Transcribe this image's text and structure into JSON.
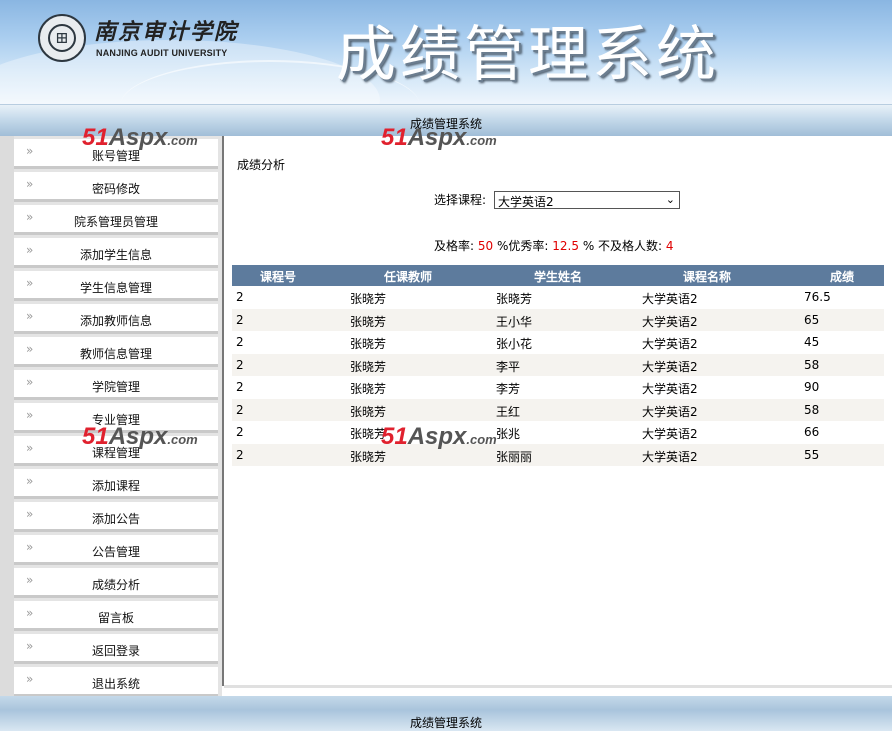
{
  "header": {
    "university_cn": "南京审计学院",
    "university_en": "NANJING AUDIT UNIVERSITY",
    "system_title": "成绩管理系统",
    "logo_icon": "university-seal-icon"
  },
  "topbar": {
    "label": "成绩管理系统"
  },
  "footer": {
    "label": "成绩管理系统"
  },
  "sidebar": {
    "items": [
      {
        "label": "账号管理"
      },
      {
        "label": "密码修改"
      },
      {
        "label": "院系管理员管理"
      },
      {
        "label": "添加学生信息"
      },
      {
        "label": "学生信息管理"
      },
      {
        "label": "添加教师信息"
      },
      {
        "label": "教师信息管理"
      },
      {
        "label": "学院管理"
      },
      {
        "label": "专业管理"
      },
      {
        "label": "课程管理"
      },
      {
        "label": "添加课程"
      },
      {
        "label": "添加公告"
      },
      {
        "label": "公告管理"
      },
      {
        "label": "成绩分析"
      },
      {
        "label": "留言板"
      },
      {
        "label": "返回登录"
      },
      {
        "label": "退出系统"
      }
    ],
    "chevron": "»"
  },
  "main": {
    "title": "成绩分析",
    "course_label": "选择课程:",
    "course_selected": "大学英语2",
    "stats": {
      "pass_label": "及格率:",
      "pass_value": "50",
      "excellent_label": "%优秀率:",
      "excellent_value": "12.5",
      "fail_label": "% 不及格人数:",
      "fail_value": "4"
    },
    "table": {
      "headers": [
        "课程号",
        "任课教师",
        "学生姓名",
        "课程名称",
        "成绩"
      ],
      "rows": [
        [
          "2",
          "张晓芳",
          "张晓芳",
          "大学英语2",
          "76.5"
        ],
        [
          "2",
          "张晓芳",
          "王小华",
          "大学英语2",
          "65"
        ],
        [
          "2",
          "张晓芳",
          "张小花",
          "大学英语2",
          "45"
        ],
        [
          "2",
          "张晓芳",
          "李平",
          "大学英语2",
          "58"
        ],
        [
          "2",
          "张晓芳",
          "李芳",
          "大学英语2",
          "90"
        ],
        [
          "2",
          "张晓芳",
          "王红",
          "大学英语2",
          "58"
        ],
        [
          "2",
          "张晓芳",
          "张兆",
          "大学英语2",
          "66"
        ],
        [
          "2",
          "张晓芳",
          "张丽丽",
          "大学英语2",
          "55"
        ]
      ]
    }
  },
  "watermark": {
    "num": "51",
    "brand": "Aspx",
    "suffix": ".com"
  },
  "colors": {
    "grid_header": "#5d7b9d",
    "alt_row": "#f5f3ef",
    "stat_value": "#e00000",
    "watermark_red": "#e0212e"
  }
}
